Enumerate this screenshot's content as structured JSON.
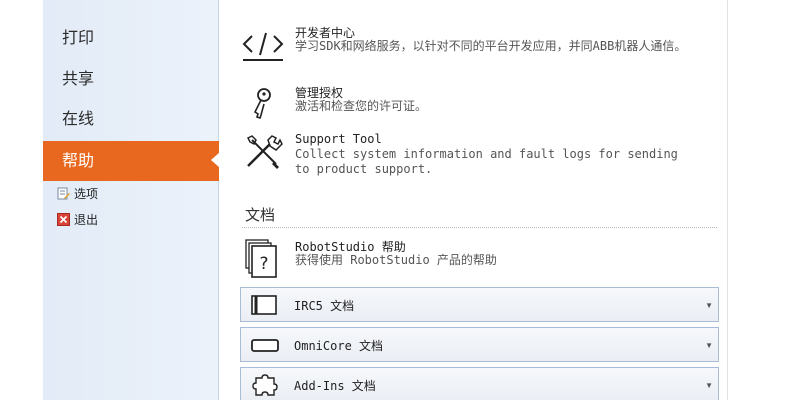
{
  "sidebar": {
    "items": [
      {
        "label": "打印"
      },
      {
        "label": "共享"
      },
      {
        "label": "在线"
      },
      {
        "label": "帮助"
      }
    ],
    "sub_items": [
      {
        "label": "选项",
        "icon": "options-icon"
      },
      {
        "label": "退出",
        "icon": "exit-icon"
      }
    ]
  },
  "entries": [
    {
      "title": "开发者中心",
      "desc": "学习SDK和网络服务，以针对不同的平台开发应用，并同ABB机器人通信。",
      "icon": "code-icon"
    },
    {
      "title": "管理授权",
      "desc": "激活和检查您的许可证。",
      "icon": "key-icon"
    },
    {
      "title": "Support Tool",
      "desc": "Collect system information and fault logs for sending to product support.",
      "icon": "tools-icon"
    }
  ],
  "documents": {
    "section_title": "文档",
    "help_entry": {
      "title": "RobotStudio 帮助",
      "desc": "获得使用 RobotStudio 产品的帮助",
      "icon": "help-document-icon"
    },
    "dropdowns": [
      {
        "label": "IRC5 文档",
        "icon": "irc5-controller-icon"
      },
      {
        "label": "OmniCore 文档",
        "icon": "omnicore-controller-icon"
      },
      {
        "label": "Add-Ins 文档",
        "icon": "puzzle-icon"
      }
    ]
  },
  "colors": {
    "active_nav": "#e9681f",
    "sidebar_bg": "#e2ebf7",
    "dropdown_border": "#a9bcd6"
  }
}
